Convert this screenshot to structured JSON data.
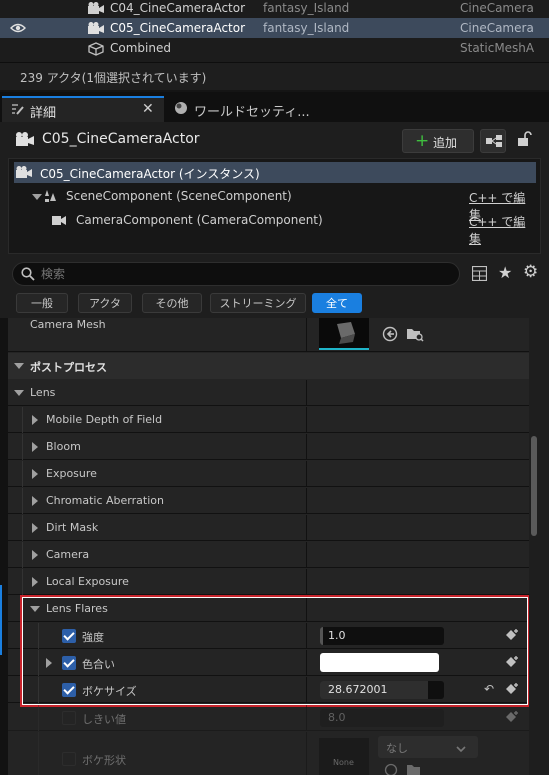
{
  "outliner": {
    "rows": [
      {
        "name": "C04_CineCameraActor",
        "level": "fantasy_Island",
        "type": "CineCamera"
      },
      {
        "name": "C05_CineCameraActor",
        "level": "fantasy_Island",
        "type": "CineCamera"
      },
      {
        "name": "Combined",
        "level": "",
        "type": "StaticMeshA"
      }
    ],
    "status": "239 アクタ(1個選択されています)"
  },
  "tabs": {
    "details": "詳細",
    "world": "ワールドセッティ..."
  },
  "actor": {
    "title": "C05_CineCameraActor",
    "add_label": "追加"
  },
  "components": {
    "root": "C05_CineCameraActor (インスタンス)",
    "items": [
      {
        "label": "SceneComponent (SceneComponent)",
        "edit": "C++ で編集"
      },
      {
        "label": "CameraComponent (CameraComponent)",
        "edit": "C++ で編集"
      }
    ]
  },
  "search": {
    "placeholder": "検索"
  },
  "filters": [
    "一般",
    "アクタ",
    "その他",
    "ストリーミング",
    "全て"
  ],
  "camera_mesh": {
    "label": "Camera Mesh"
  },
  "sections": {
    "postprocess": "ポストプロセス",
    "lens": "Lens"
  },
  "lens_groups": [
    "Mobile Depth of Field",
    "Bloom",
    "Exposure",
    "Chromatic Aberration",
    "Dirt Mask",
    "Camera",
    "Local Exposure"
  ],
  "lens_flares": {
    "title": "Lens Flares",
    "intensity_label": "強度",
    "intensity_value": "1.0",
    "tint_label": "色合い",
    "bokeh_size_label": "ボケサイズ",
    "bokeh_size_value": "28.672001",
    "threshold_label": "しきい値",
    "threshold_value": "8.0",
    "bokeh_shape_label": "ボケ形状",
    "bokeh_shape_thumb": "None",
    "bokeh_shape_value": "なし"
  },
  "colors": {
    "selection": "#3d4a5c",
    "highlight_border": "#c8242c",
    "accent_blue": "#1a7fe0",
    "check_blue": "#2d5fa8",
    "add_green": "#3fbf3f"
  }
}
